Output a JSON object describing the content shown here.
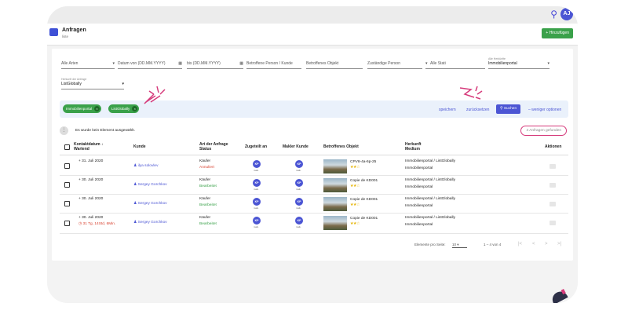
{
  "topbar": {
    "avatar_text": "AJ"
  },
  "header": {
    "title": "Anfragen",
    "subtitle": "liste",
    "add_label": "+ Hinzufügen"
  },
  "filters": [
    {
      "key": "art",
      "label": "Alle Arten"
    },
    {
      "key": "von",
      "label": "Datum von (DD.MM.YYYY)"
    },
    {
      "key": "bis",
      "label": "bis (DD.MM.YYYY)"
    },
    {
      "key": "person",
      "label": "Betroffene Person / Kunde"
    },
    {
      "key": "objekt",
      "label": "Betroffenes Objekt"
    },
    {
      "key": "zust",
      "label": "Zuständige Person"
    },
    {
      "key": "stati",
      "label": "Alle Stati"
    },
    {
      "key": "herkunft",
      "top_label": "Alle Herkünfte",
      "label": "Immobilienportal"
    }
  ],
  "source_filter": {
    "top_label": "Herkunft der Anfrage",
    "label": "ListGlobally"
  },
  "chips": [
    {
      "label": "Immobilienportal"
    },
    {
      "label": "ListGlobally"
    }
  ],
  "actions": {
    "save": "speichern",
    "reset": "zurücksetzen",
    "search": "Suchen",
    "less": "– weniger optionen"
  },
  "info": {
    "none_selected": "Es wurde kein Element ausgewählt.",
    "found": "4 Anfragen gefunden"
  },
  "columns": {
    "kontakt": "Kontaktdatum ↓",
    "wartend": "Wartend",
    "kunde": "Kunde",
    "art": "Art der Anfrage",
    "status": "Status",
    "zugeteilt": "Zugeteilt an",
    "makler": "Makler Kunde",
    "objekt": "Betroffenes Objekt",
    "herkunft": "Herkunft",
    "medium": "Medium",
    "aktionen": "Aktionen"
  },
  "rows": [
    {
      "date": "31. Juli 2020",
      "warn": "",
      "kunde": "ilya solovlev",
      "art": "Käufer",
      "status": "Annuliert",
      "status_type": "ann",
      "badge": "KP",
      "badge_sub": "maik.",
      "objekt": "CPV8-4a-6p-25",
      "stars": 2,
      "herkunft": "Immobilienportal / ListGlobally",
      "medium": "Immobilienportal"
    },
    {
      "date": "30. Juli 2020",
      "warn": "",
      "kunde": "Sergey Gorchkov",
      "art": "Käufer",
      "status": "Bearbeitet",
      "status_type": "bea",
      "badge": "KP",
      "badge_sub": "maik.",
      "objekt": "Copie de KD001",
      "stars": 2,
      "herkunft": "Immobilienportal / ListGlobally",
      "medium": "Immobilienportal"
    },
    {
      "date": "30. Juli 2020",
      "warn": "",
      "kunde": "Sergey Gorchkov",
      "art": "Käufer",
      "status": "Bearbeitet",
      "status_type": "bea",
      "badge": "KP",
      "badge_sub": "maik.",
      "objekt": "Copie de KD001",
      "stars": 2,
      "herkunft": "Immobilienportal / ListGlobally",
      "medium": "Immobilienportal"
    },
    {
      "date": "30. Juli 2020",
      "warn": "31 Tg, 14Std, 6Min.",
      "kunde": "Sergey Gorchkov",
      "art": "Käufer",
      "status": "Bearbeitet",
      "status_type": "bea",
      "badge": "KP",
      "badge_sub": "maik.",
      "objekt": "Copie de KD001",
      "stars": 2,
      "herkunft": "Immobilienportal / ListGlobally",
      "medium": "Immobilienportal"
    }
  ],
  "pager": {
    "per_page_label": "Elemente pro Seite:",
    "per_page": "10",
    "range": "1 – 4 von 4"
  },
  "colors": {
    "accent": "#4b55d4",
    "green": "#3aa14a",
    "warn": "#d8412f",
    "highlight": "#d63b7b"
  }
}
